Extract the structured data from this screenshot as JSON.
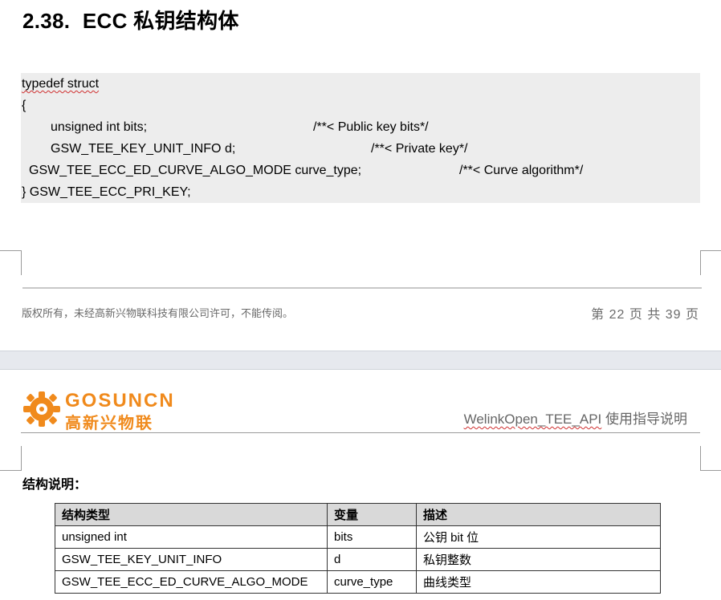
{
  "section": {
    "number": "2.38.",
    "title": "ECC 私钥结构体"
  },
  "code": {
    "typedef": "typedef struct",
    "open_brace": "{",
    "field1_decl": "unsigned int bits;",
    "field1_comment": "/**< Public key bits*/",
    "field2_decl": "GSW_TEE_KEY_UNIT_INFO d;",
    "field2_comment": "/**< Private key*/",
    "field3_decl": "GSW_TEE_ECC_ED_CURVE_ALGO_MODE curve_type;",
    "field3_comment": "/**< Curve algorithm*/",
    "close_line": "} GSW_TEE_ECC_PRI_KEY;"
  },
  "footer": {
    "copyright": "版权所有，未经高新兴物联科技有限公司许可，不能传阅。",
    "page_info": "第 22 页 共 39 页"
  },
  "header": {
    "logo_en": "GOSUNCN",
    "logo_cn": "高新兴物联",
    "doc_title_brand": "WelinkOpen_TEE_API",
    "doc_title_rest": " 使用指导说明"
  },
  "structure_label": "结构说明：",
  "table": {
    "headers": [
      "结构类型",
      "变量",
      "描述"
    ],
    "rows": [
      [
        "unsigned int",
        "bits",
        "公钥 bit 位"
      ],
      [
        "GSW_TEE_KEY_UNIT_INFO",
        "d",
        "私钥整数"
      ],
      [
        "GSW_TEE_ECC_ED_CURVE_ALGO_MODE",
        "curve_type",
        "曲线类型"
      ]
    ]
  },
  "colors": {
    "brand_orange": "#f08a1c",
    "code_bg": "#ededed",
    "table_header_bg": "#d9d9d9"
  }
}
